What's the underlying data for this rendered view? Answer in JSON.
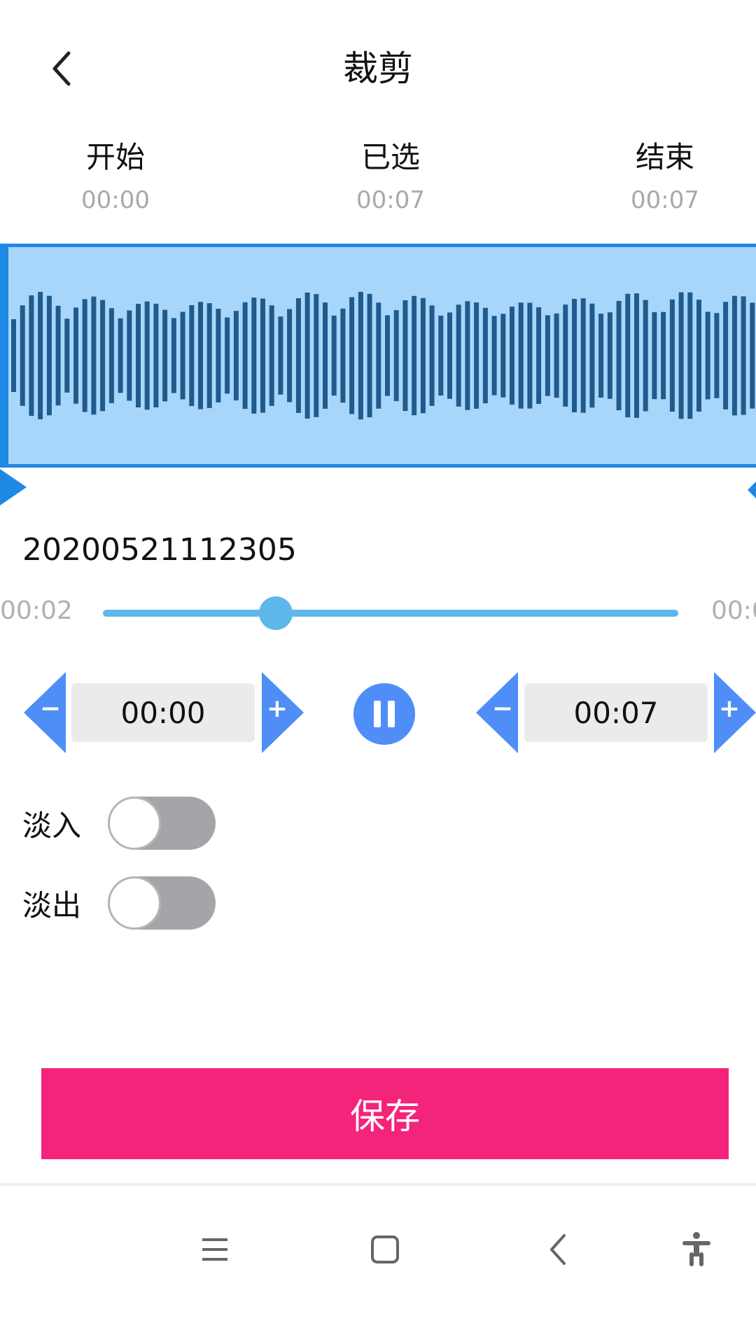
{
  "header": {
    "title": "裁剪",
    "back_icon": "chevron-left-icon"
  },
  "stats": [
    {
      "label": "开始",
      "time": "00:00"
    },
    {
      "label": "已选",
      "time": "00:07"
    },
    {
      "label": "结束",
      "time": "00:07"
    }
  ],
  "waveform": {
    "fill_color": "#a8d6fb",
    "border_color": "#1e88e5",
    "bar_color": "#1f5b8c",
    "selection_start": 0.0,
    "selection_end": 1.0
  },
  "file": {
    "name": "20200521112305"
  },
  "playback": {
    "current_time": "00:02",
    "end_time": "00:0",
    "progress": 0.3
  },
  "start_stepper": {
    "value": "00:00",
    "minus_label": "−",
    "plus_label": "+"
  },
  "end_stepper": {
    "value": "00:07",
    "minus_label": "−",
    "plus_label": "+"
  },
  "play_button": {
    "icon": "pause-icon"
  },
  "fade_in": {
    "label": "淡入",
    "enabled": false
  },
  "fade_out": {
    "label": "淡出",
    "enabled": false
  },
  "save_button": {
    "label": "保存",
    "color": "#f4247b"
  },
  "nav_bar": {
    "icons": [
      "menu-icon",
      "home-icon",
      "back-icon",
      "accessibility-icon"
    ]
  }
}
